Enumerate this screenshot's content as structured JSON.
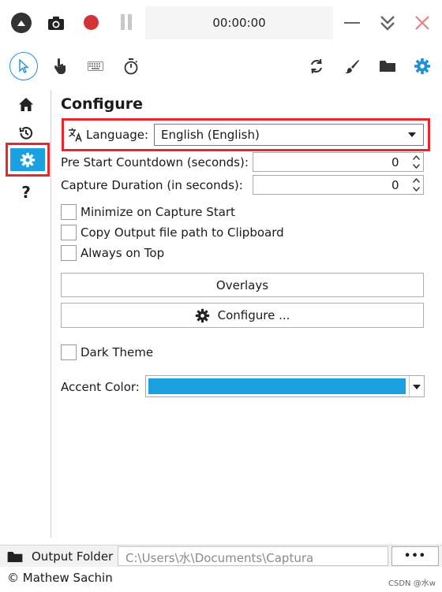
{
  "titlebar": {
    "timer": "00:00:00",
    "colors": {
      "record": "#d13438",
      "close": "#e87c7c",
      "pause": "#c8c8c8"
    }
  },
  "toolbar": {
    "left_icons": [
      "cursor-icon",
      "hand-icon",
      "keyboard-icon",
      "stopwatch-icon"
    ],
    "right_icons": [
      "refresh-icon",
      "brush-icon",
      "folder-icon",
      "gear-icon"
    ],
    "accent": "#1e90d6"
  },
  "sidebar": {
    "items": [
      "home-icon",
      "history-icon",
      "gear-icon",
      "help-icon"
    ],
    "help_glyph": "?"
  },
  "configure": {
    "title": "Configure",
    "language_label": "Language:",
    "language_value": "English (English)",
    "countdown_label": "Pre Start Countdown (seconds):",
    "countdown_value": "0",
    "duration_label": "Capture Duration (in seconds):",
    "duration_value": "0",
    "checkboxes": {
      "minimize": "Minimize on Capture Start",
      "copy_path": "Copy Output file path to Clipboard",
      "always_top": "Always on Top",
      "dark_theme": "Dark Theme"
    },
    "overlays_button": "Overlays",
    "configure_button": "Configure ...",
    "accent_label": "Accent Color:",
    "accent_color": "#1ba1e2"
  },
  "footer": {
    "output_label": "Output Folder",
    "output_path": "C:\\Users\\水\\Documents\\Captura",
    "more_label": "•••",
    "credit": "© Mathew Sachin",
    "watermark": "CSDN @水w"
  }
}
